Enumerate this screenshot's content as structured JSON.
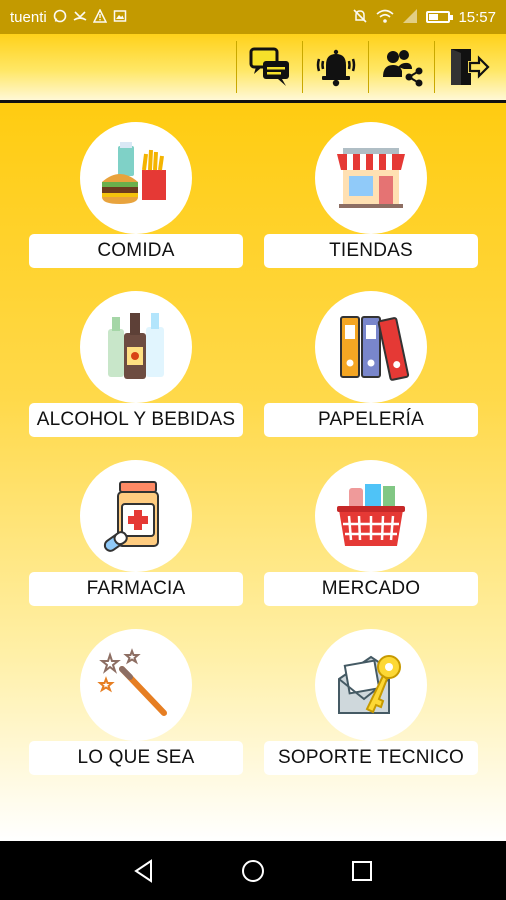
{
  "status_bar": {
    "carrier": "tuenti",
    "time": "15:57",
    "battery_level": 0.45,
    "left_icons": [
      "whatsapp-icon",
      "missed-call-icon",
      "warning-icon",
      "image-icon"
    ],
    "right_icons": [
      "mute-icon",
      "wifi-icon",
      "signal-icon",
      "battery-icon"
    ]
  },
  "toolbar": {
    "actions": [
      "chat-icon",
      "notifications-bell-icon",
      "share-users-icon",
      "logout-icon"
    ]
  },
  "categories": [
    {
      "label": "COMIDA",
      "icon": "food-icon"
    },
    {
      "label": "TIENDAS",
      "icon": "store-icon"
    },
    {
      "label": "ALCOHOL Y BEBIDAS",
      "icon": "bottles-icon"
    },
    {
      "label": "PAPELERÍA",
      "icon": "binders-icon"
    },
    {
      "label": "FARMACIA",
      "icon": "medicine-icon"
    },
    {
      "label": "MERCADO",
      "icon": "shopping-basket-icon"
    },
    {
      "label": "LO QUE SEA",
      "icon": "magic-wand-icon"
    },
    {
      "label": "SOPORTE TECNICO",
      "icon": "envelope-key-icon"
    }
  ],
  "nav_bar": {
    "buttons": [
      "back-icon",
      "home-icon",
      "recents-icon"
    ]
  },
  "colors": {
    "status_bar": "#c39a00",
    "accent_yellow": "#ffcc11",
    "label_bg": "#ffffff"
  }
}
